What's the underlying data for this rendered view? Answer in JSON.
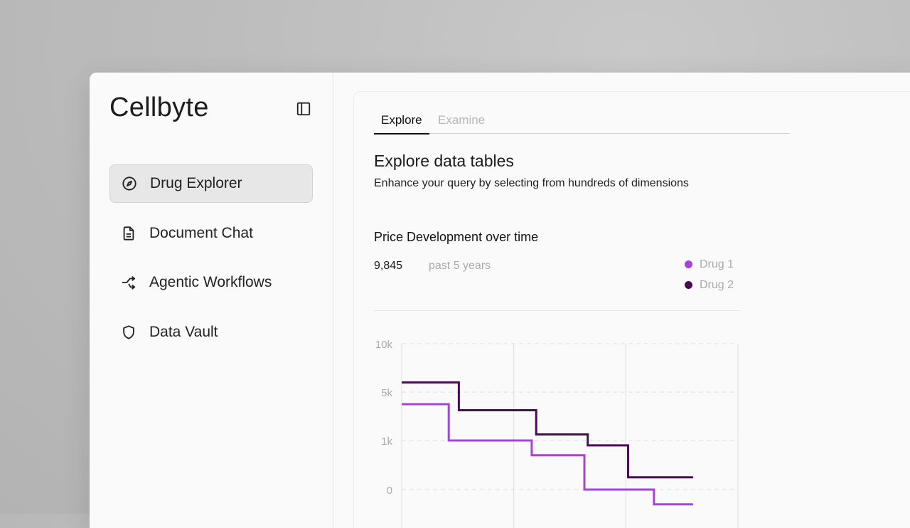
{
  "app": {
    "brand": "Cellbyte"
  },
  "sidebar": {
    "items": [
      {
        "label": "Drug Explorer",
        "icon": "compass-icon",
        "active": true
      },
      {
        "label": "Document Chat",
        "icon": "document-icon",
        "active": false
      },
      {
        "label": "Agentic Workflows",
        "icon": "workflow-icon",
        "active": false
      },
      {
        "label": "Data Vault",
        "icon": "shield-icon",
        "active": false
      }
    ]
  },
  "main": {
    "tabs": [
      {
        "label": "Explore",
        "active": true
      },
      {
        "label": "Examine",
        "active": false
      }
    ],
    "title": "Explore data tables",
    "subtitle": "Enhance your query by selecting from hundreds of dimensions",
    "chart_header": {
      "title": "Price Development over time",
      "value": "9,845",
      "period": "past 5 years"
    }
  },
  "colors": {
    "drug1": "#a445d8",
    "drug2": "#4a0a55",
    "grid": "#dddddd",
    "axis_text": "#aaaaaa"
  },
  "chart_data": {
    "type": "line",
    "step": true,
    "title": "Price Development over time",
    "yticks": [
      "10k",
      "5k",
      "1k",
      "0"
    ],
    "grid": true,
    "legend_placement": "top-right",
    "series": [
      {
        "name": "Drug 1",
        "color": "#a445d8",
        "points": [
          [
            0,
            4000
          ],
          [
            0.42,
            4000
          ],
          [
            0.42,
            1000
          ],
          [
            1.16,
            1000
          ],
          [
            1.16,
            700
          ],
          [
            1.63,
            700
          ],
          [
            1.63,
            0
          ],
          [
            2.25,
            0
          ],
          [
            2.25,
            -300
          ],
          [
            2.6,
            -300
          ]
        ]
      },
      {
        "name": "Drug 2",
        "color": "#4a0a55",
        "points": [
          [
            0,
            6000
          ],
          [
            0.51,
            6000
          ],
          [
            0.51,
            3500
          ],
          [
            1.2,
            3500
          ],
          [
            1.2,
            1500
          ],
          [
            1.66,
            1500
          ],
          [
            1.66,
            900
          ],
          [
            2.02,
            900
          ],
          [
            2.02,
            250
          ],
          [
            2.6,
            250
          ]
        ]
      }
    ]
  }
}
